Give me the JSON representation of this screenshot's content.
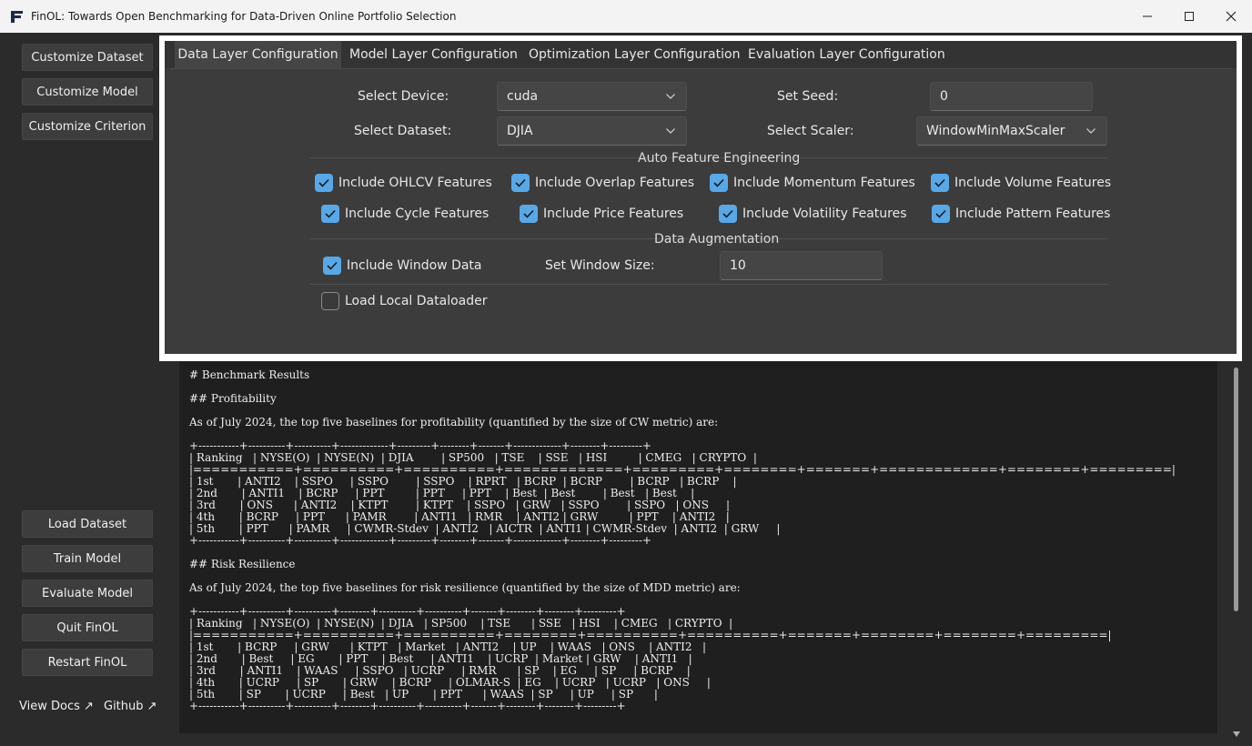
{
  "window": {
    "title": "FinOL: Towards Open Benchmarking for Data-Driven Online Portfolio Selection"
  },
  "sidebar": {
    "top_buttons": [
      "Customize Dataset",
      "Customize Model",
      "Customize Criterion"
    ],
    "bottom_buttons": [
      "Load Dataset",
      "Train Model",
      "Evaluate Model",
      "Quit FinOL",
      "Restart FinOL"
    ],
    "links": [
      "View Docs ↗",
      "Github ↗"
    ]
  },
  "config": {
    "tabs": [
      "Data Layer Configuration",
      "Model Layer Configuration",
      "Optimization Layer Configuration",
      "Evaluation Layer Configuration"
    ],
    "active_tab": "Data Layer Configuration",
    "device": {
      "label": "Select Device:",
      "value": "cuda"
    },
    "seed": {
      "label": "Set Seed:",
      "value": "0"
    },
    "dataset": {
      "label": "Select Dataset:",
      "value": "DJIA"
    },
    "scaler": {
      "label": "Select Scaler:",
      "value": "WindowMinMaxScaler"
    },
    "feature_section": "Auto Feature Engineering",
    "features": [
      {
        "label": "Include OHLCV Features",
        "checked": true
      },
      {
        "label": "Include Overlap Features",
        "checked": true
      },
      {
        "label": "Include Momentum Features",
        "checked": true
      },
      {
        "label": "Include Volume Features",
        "checked": true
      },
      {
        "label": "Include Cycle Features",
        "checked": true
      },
      {
        "label": "Include Price Features",
        "checked": true
      },
      {
        "label": "Include Volatility Features",
        "checked": true
      },
      {
        "label": "Include Pattern Features",
        "checked": true
      }
    ],
    "augment_section": "Data Augmentation",
    "window_data": {
      "label": "Include Window Data",
      "checked": true
    },
    "window_size": {
      "label": "Set Window Size:",
      "value": "10"
    },
    "local_loader": {
      "label": "Load Local Dataloader",
      "checked": false
    }
  },
  "output": {
    "heading": "# Benchmark Results",
    "profit_heading": "## Profitability",
    "profit_text": "As of July 2024, the top five baselines for profitability (quantified by the size of CW metric) are:",
    "profit_table": {
      "border": "+-----------+----------+----------+-------------+---------+--------+-------+-------------+--------+---------+",
      "header": "| Ranking   | NYSE(O)  | NYSE(N)  | DJIA        | SP500   | TSE    | SSE   | HSI         | CMEG   | CRYPTO  |",
      "sep": "|===========+==========+==========+=============+=========+========+=======+=============+========+=========|",
      "rows": [
        "| 1st       | ANTI2    | SSPO     | SSPO        | SSPO    | RPRT   | BCRP  | BCRP        | BCRP   | BCRP    |",
        "| 2nd       | ANTI1    | BCRP     | PPT         | PPT     | PPT    | Best  | Best        | Best   | Best    |",
        "| 3rd       | ONS      | ANTI2    | KTPT        | KTPT    | SSPO   | GRW   | SSPO        | SSPO   | ONS     |",
        "| 4th       | BCRP     | PPT      | PAMR        | ANTI1   | RMR    | ANTI2 | GRW         | PPT    | ANTI2   |",
        "| 5th       | PPT      | PAMR     | CWMR-Stdev  | ANTI2   | AICTR  | ANTI1 | CWMR-Stdev  | ANTI2  | GRW     |"
      ]
    },
    "risk_heading": "## Risk Resilience",
    "risk_text": "As of July 2024, the top five baselines for risk resilience (quantified by the size of MDD metric) are:",
    "risk_table": {
      "border": "+-----------+----------+----------+--------+----------+----------+-------+--------+--------+---------+",
      "header": "| Ranking   | NYSE(O)  | NYSE(N)  | DJIA   | SP500    | TSE      | SSE   | HSI    | CMEG   | CRYPTO  |",
      "sep": "|===========+==========+==========+========+==========+==========+=======+========+========+=========|",
      "rows": [
        "| 1st       | BCRP     | GRW      | KTPT   | Market   | ANTI2    | UP    | WAAS   | ONS    | ANTI2   |",
        "| 2nd       | Best     | EG       | PPT    | Best     | ANTI1    | UCRP  | Market | GRW    | ANTI1   |",
        "| 3rd       | ANTI1    | WAAS     | SSPO   | UCRP     | RMR      | SP    | EG     | SP     | BCRP    |",
        "| 4th       | UCRP     | SP       | GRW    | BCRP     | OLMAR-S  | EG    | UCRP   | UCRP   | ONS     |",
        "| 5th       | SP       | UCRP     | Best   | UP       | PPT      | WAAS  | SP     | UP     | SP      |"
      ]
    }
  }
}
